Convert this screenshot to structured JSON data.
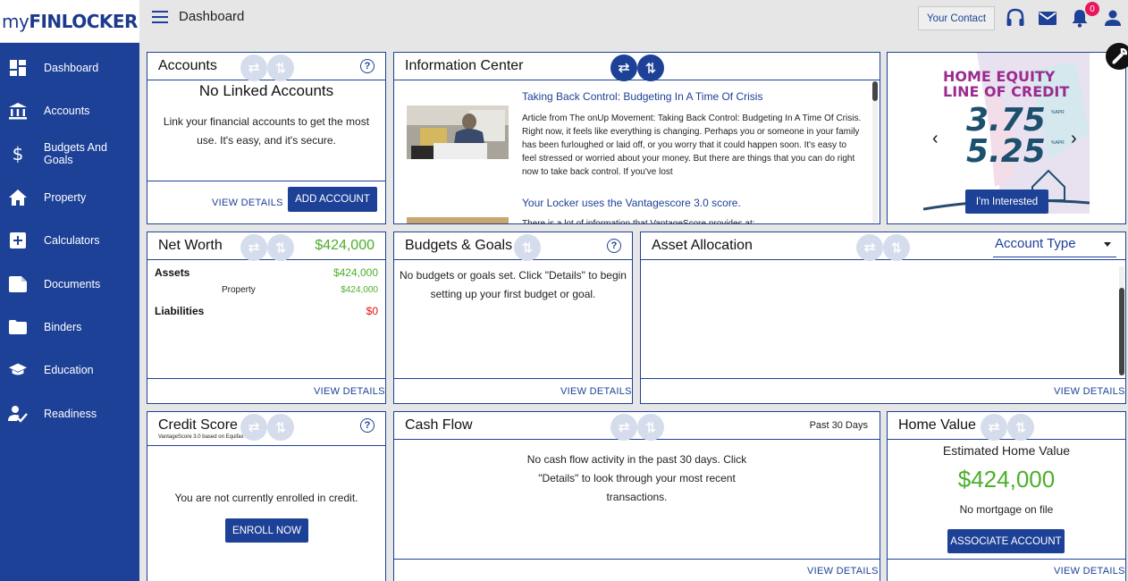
{
  "brand": {
    "prefix": "my",
    "name": "FINLOCKER"
  },
  "sidebar": {
    "items": [
      {
        "label": "Dashboard",
        "icon": "dashboard-icon"
      },
      {
        "label": "Accounts",
        "icon": "bank-icon"
      },
      {
        "label": "Budgets And Goals",
        "icon": "dollar-icon"
      },
      {
        "label": "Property",
        "icon": "home-icon"
      },
      {
        "label": "Calculators",
        "icon": "plus-box-icon"
      },
      {
        "label": "Documents",
        "icon": "document-icon"
      },
      {
        "label": "Binders",
        "icon": "folder-icon"
      },
      {
        "label": "Education",
        "icon": "graduation-cap-icon"
      },
      {
        "label": "Readiness",
        "icon": "person-check-icon"
      }
    ]
  },
  "header": {
    "title": "Dashboard",
    "contact_label": "Your Contact",
    "notification_count": "0"
  },
  "accounts": {
    "title": "Accounts",
    "heading": "No Linked Accounts",
    "body": "Link your financial accounts to get the most use. It's easy, and it's secure.",
    "view_details": "VIEW DETAILS",
    "add_account": "ADD ACCOUNT"
  },
  "info_center": {
    "title": "Information Center",
    "articles": [
      {
        "title": "Taking Back Control: Budgeting In A Time Of Crisis",
        "body": "Article from The onUp Movement: Taking Back Control: Budgeting In A Time Of Crisis. Right now, it feels like everything is changing. Perhaps you or someone in your family has been furloughed or laid off,  or you worry that it could happen soon. It's easy to feel stressed or worried about your money. But there are things that you can do right now to take back control. If you've lost"
      },
      {
        "title": "Your Locker uses the Vantagescore 3.0 score.",
        "body": "There is a lot of information that VantageScore provides at:"
      }
    ]
  },
  "promo": {
    "headline_line1": "HOME EQUITY",
    "headline_line2": "LINE OF CREDIT",
    "rate1": "3.75",
    "rate2": "5.25",
    "rate_note1": "%APR",
    "rate_note2": "%APR",
    "cta": "I'm Interested",
    "prev": "‹",
    "next": "›"
  },
  "net_worth": {
    "title": "Net Worth",
    "total": "$424,000",
    "assets_label": "Assets",
    "assets_value": "$424,000",
    "property_label": "Property",
    "property_value": "$424,000",
    "liabilities_label": "Liabilities",
    "liabilities_value": "$0",
    "view_details": "VIEW DETAILS"
  },
  "budgets": {
    "title": "Budgets & Goals",
    "body": "No budgets or goals set. Click \"Details\" to begin setting up your first budget or goal.",
    "view_details": "VIEW DETAILS"
  },
  "asset_allocation": {
    "title": "Asset Allocation",
    "select_value": "Account Type",
    "view_details": "VIEW DETAILS"
  },
  "credit_score": {
    "title": "Credit Score",
    "subtitle": "VantageScore 3.0 based on Equifax data",
    "body": "You are not currently enrolled in credit.",
    "enroll": "ENROLL NOW"
  },
  "cash_flow": {
    "title": "Cash Flow",
    "period": "Past 30 Days",
    "body": "No cash flow activity in the past 30 days. Click \"Details\" to look through your most recent transactions.",
    "view_details": "VIEW DETAILS"
  },
  "home_value": {
    "title": "Home Value",
    "heading": "Estimated Home Value",
    "value": "$424,000",
    "mortgage": "No mortgage on file",
    "associate": "ASSOCIATE ACCOUNT",
    "view_details": "VIEW DETAILS"
  },
  "colors": {
    "brand_blue": "#1d4197",
    "positive_green": "#4caf2a",
    "negative_red": "#e01010",
    "badge_pink": "#e8175d"
  }
}
